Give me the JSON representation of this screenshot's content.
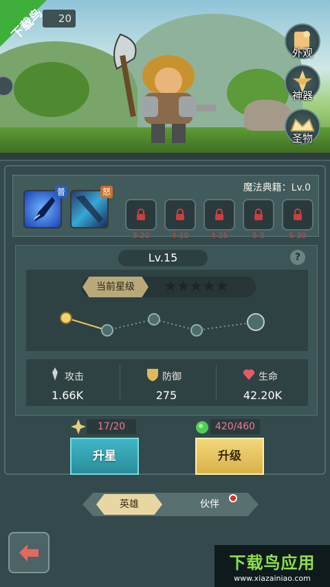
{
  "watermark": {
    "badge_text": "下载鸟",
    "brand_text": "下载鸟应用",
    "brand_url": "www.xiazainiao.com"
  },
  "top_chip": {
    "value": "20"
  },
  "side_buttons": [
    {
      "label": "外观",
      "icon": "appearance-icon"
    },
    {
      "label": "神器",
      "icon": "artifact-icon"
    },
    {
      "label": "圣物",
      "icon": "relic-icon"
    }
  ],
  "skills": {
    "skill1_tag": "普",
    "skill2_tag": "怒",
    "book_label": "魔法典籍：Lv.0",
    "locked_slots": [
      "3-20",
      "4-10",
      "4-25",
      "5-5",
      "5-30"
    ]
  },
  "level": {
    "label": "Lv.15",
    "help": "?"
  },
  "star": {
    "label": "当前星级",
    "stars_display": "★★★★★",
    "filled": 0,
    "max": 5
  },
  "stats": [
    {
      "name": "攻击",
      "value": "1.66K",
      "icon": "attack-icon"
    },
    {
      "name": "防御",
      "value": "275",
      "icon": "defense-icon"
    },
    {
      "name": "生命",
      "value": "42.20K",
      "icon": "heart-icon"
    }
  ],
  "costs": {
    "star": "17/20",
    "level": "420/460"
  },
  "buttons": {
    "star_up": "升星",
    "level_up": "升级"
  },
  "tabs": {
    "hero": "英雄",
    "partner": "伙伴"
  },
  "colors": {
    "panel": "#33494b",
    "star_button": "#3fb7c7",
    "level_button": "#e8c55c",
    "cost_text": "#f07a9a"
  }
}
